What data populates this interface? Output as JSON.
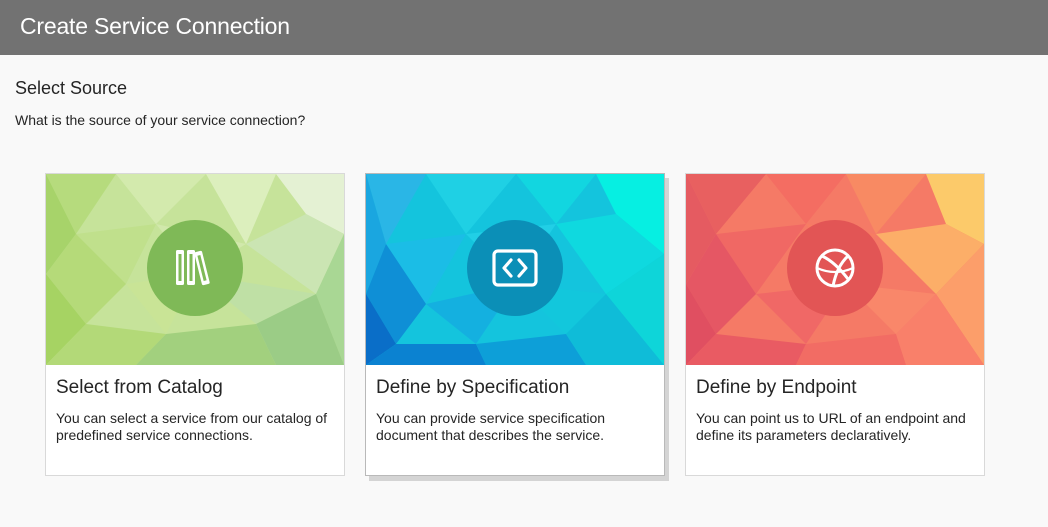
{
  "window": {
    "title": "Create Service Connection"
  },
  "section": {
    "title": "Select Source",
    "subtitle": "What is the source of your service connection?"
  },
  "cards": [
    {
      "title": "Select from Catalog",
      "description": "You can select a service from our catalog of predefined service connections.",
      "icon": "books-icon",
      "theme": "green"
    },
    {
      "title": "Define by Specification",
      "description": "You can provide service specification document that describes the service.",
      "icon": "code-brackets-icon",
      "theme": "cyan",
      "selected": true
    },
    {
      "title": "Define by Endpoint",
      "description": "You can point us to URL of an endpoint and define its parameters declaratively.",
      "icon": "globe-icon",
      "theme": "coral"
    }
  ],
  "colors": {
    "titlebar": "#727272",
    "green_circle": "#7fb957",
    "cyan_circle": "#0b8fb7",
    "coral_circle": "#e25555"
  }
}
